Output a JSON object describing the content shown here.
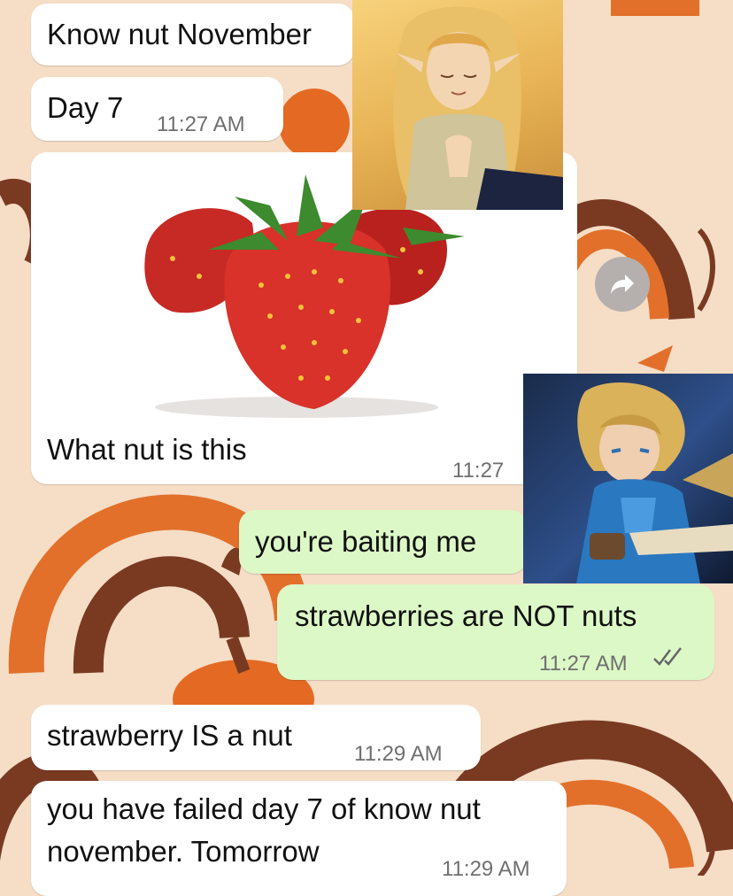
{
  "messages": {
    "m1": {
      "text": "Know nut November"
    },
    "m2": {
      "text": "Day 7",
      "time": "11:27 AM"
    },
    "m3": {
      "caption": "What nut is this",
      "time": "11:27",
      "image": "strawberry-photo"
    },
    "m4": {
      "text": "you're baiting me"
    },
    "m5": {
      "text": "strawberries are NOT nuts",
      "time": "11:27 AM",
      "status": "read-double-check"
    },
    "m6": {
      "text": "strawberry IS a nut",
      "time": "11:29 AM"
    },
    "m7": {
      "line1": "you have failed day 7 of know nut",
      "line2": "november. Tomorrow",
      "time": "11:29 AM"
    }
  },
  "stickers": {
    "top": "zelda-princess-sticker",
    "right": "link-hero-sticker"
  },
  "icons": {
    "forward": "forward-arrow-icon",
    "read": "double-check-icon"
  },
  "colors": {
    "wallpaper": "#f5ddc6",
    "incoming": "#ffffff",
    "outgoing": "#dcf8c6",
    "rainbow_dark": "#7a3a22",
    "rainbow_orange": "#e2702a",
    "pumpkin": "#e46a24"
  }
}
